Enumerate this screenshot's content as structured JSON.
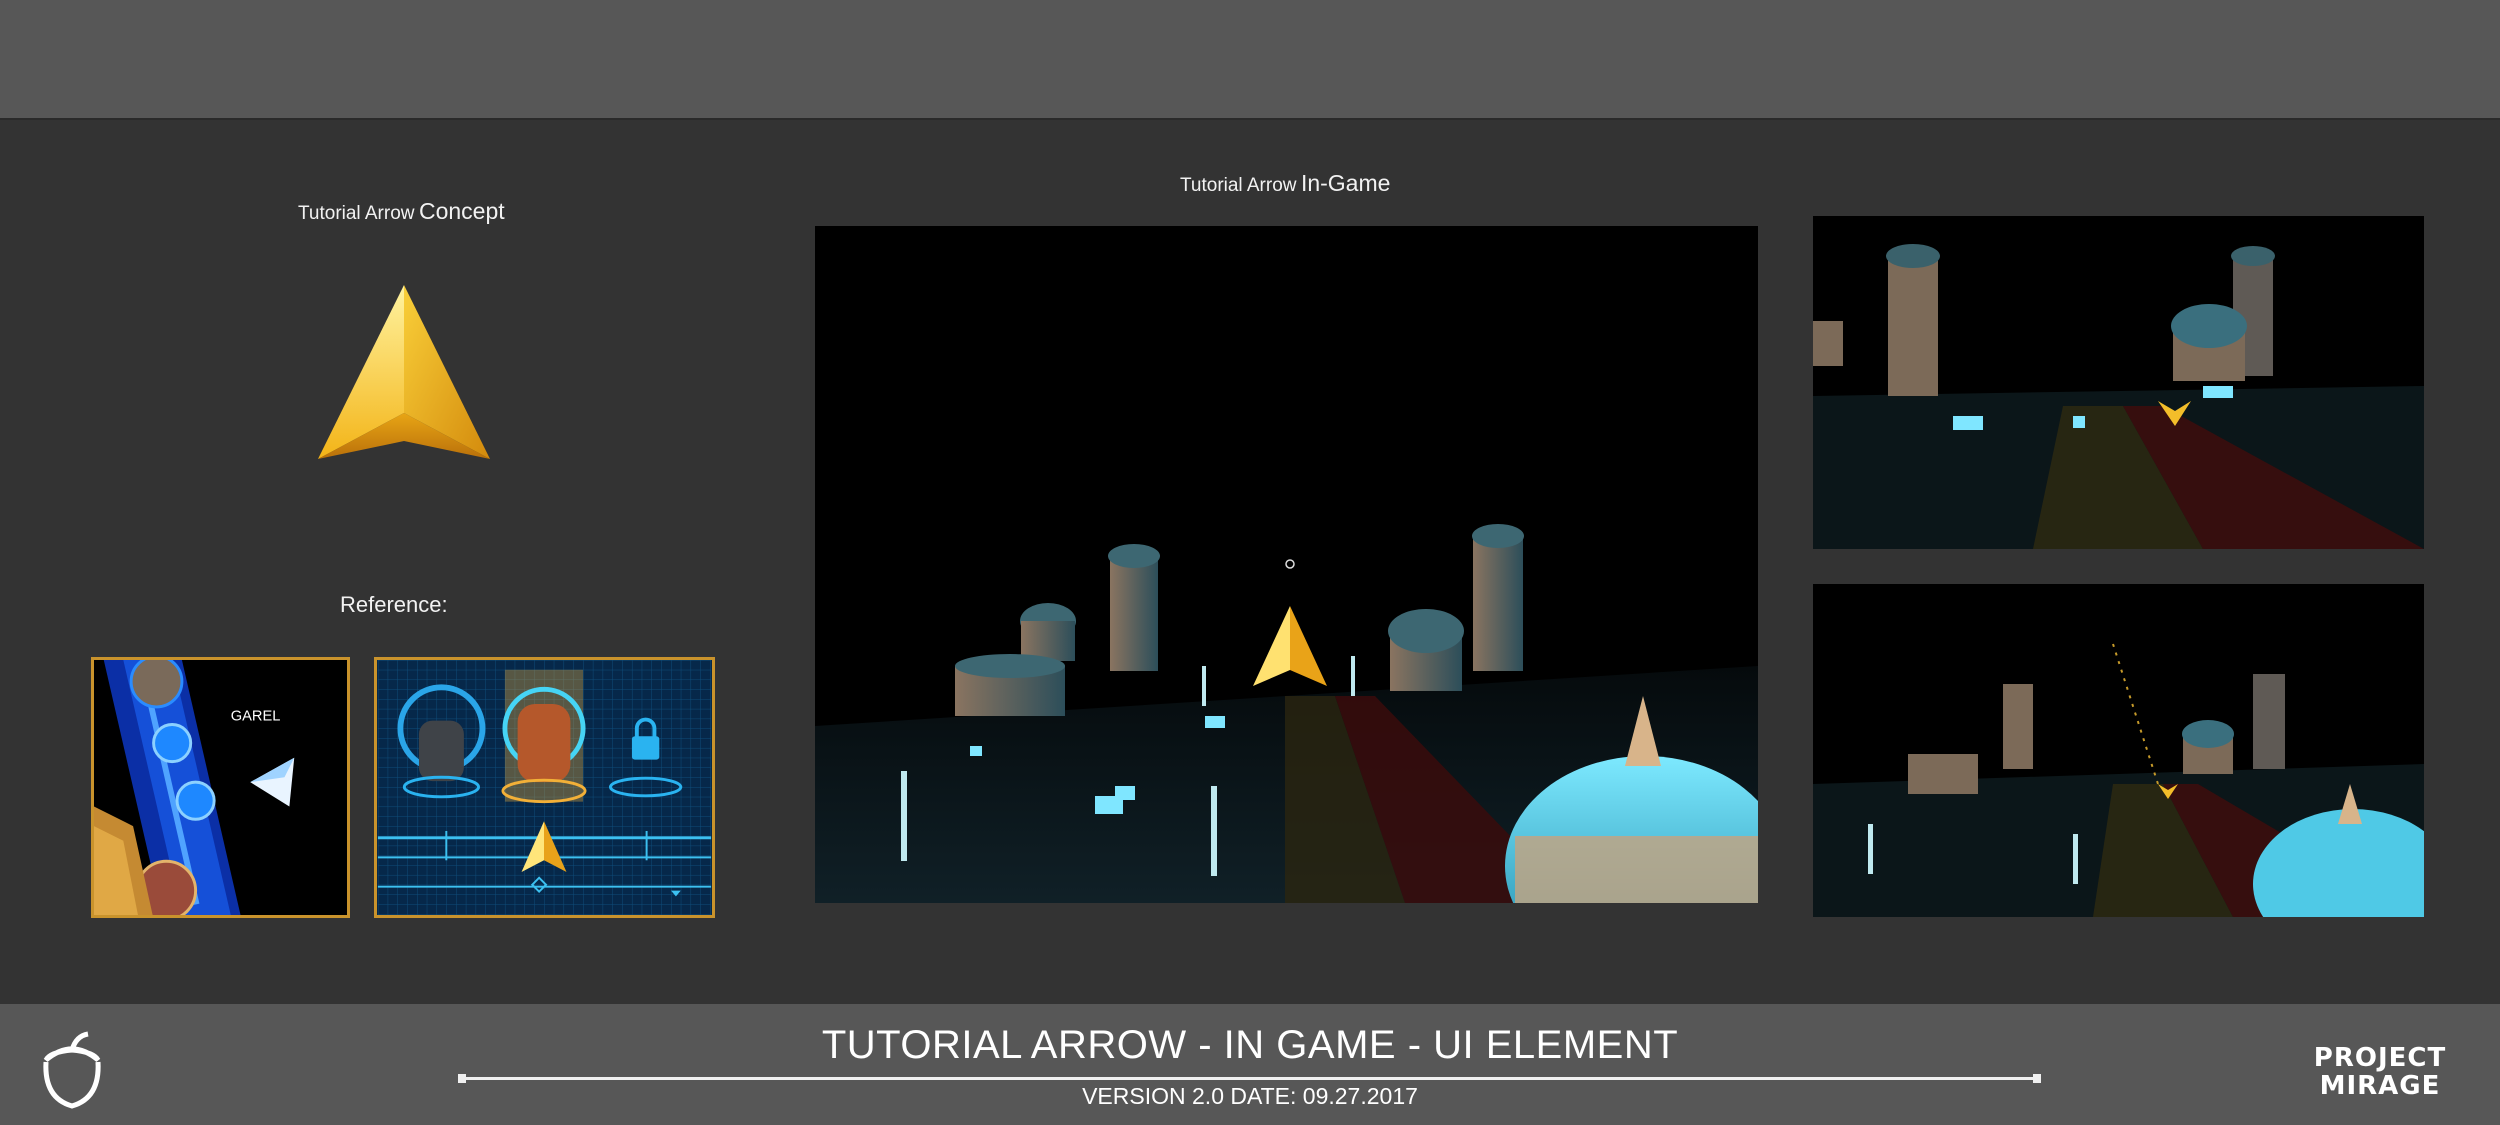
{
  "concept": {
    "title_small": "Tutorial Arrow",
    "title_big": "Concept"
  },
  "ingame": {
    "title_small": "Tutorial Arrow",
    "title_big": "In-Game"
  },
  "reference": {
    "title": "Reference:",
    "character_name": "GAREL"
  },
  "footer": {
    "title": "TUTORIAL ARROW - IN GAME - UI ELEMENT",
    "subtitle": "VERSION 2.0 DATE: 09.27.2017",
    "brand_line1": "PROJECT",
    "brand_line2": "MIRAGE"
  },
  "icons": {
    "logo": "acorn-logo-icon",
    "arrow": "tutorial-arrow-icon"
  },
  "colors": {
    "background": "#333333",
    "band": "#575757",
    "arrow_gold": "#f5c21d",
    "frame_gold": "#c9932c",
    "hologram_cyan": "#49d7f0"
  }
}
